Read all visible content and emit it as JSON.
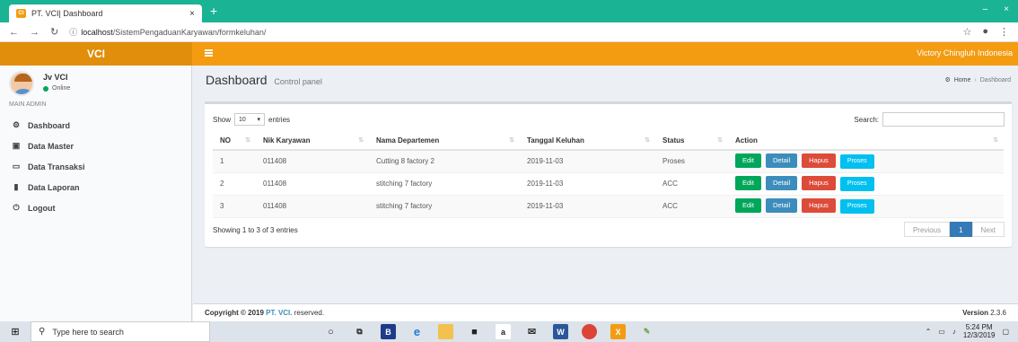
{
  "browser": {
    "tab_title": "PT. VCI| Dashboard",
    "tab_close": "×",
    "new_tab": "+",
    "minimize": "–",
    "close": "×",
    "url_host": "localhost",
    "url_path": "/SistemPengaduanKaryawan/formkeluhan/"
  },
  "header": {
    "logo": "VCI",
    "company": "Victory Chingluh Indonesia"
  },
  "sidebar": {
    "user_name": "Jv VCI",
    "user_status": "Online",
    "nav_header": "MAIN ADMIN",
    "items": [
      {
        "label": "Dashboard",
        "icon": "dashboard-icon"
      },
      {
        "label": "Data Master",
        "icon": "id-card-icon"
      },
      {
        "label": "Data Transaksi",
        "icon": "monitor-icon"
      },
      {
        "label": "Data Laporan",
        "icon": "book-icon"
      },
      {
        "label": "Logout",
        "icon": "power-icon"
      }
    ]
  },
  "content": {
    "title": "Dashboard",
    "subtitle": "Control panel",
    "breadcrumb_home": "Home",
    "breadcrumb_current": "Dashboard"
  },
  "table": {
    "show_label": "Show",
    "entries_value": "10",
    "entries_label": "entries",
    "search_label": "Search:",
    "columns": [
      "NO",
      "Nik Karyawan",
      "Nama Departemen",
      "Tanggal Keluhan",
      "Status",
      "Action"
    ],
    "rows": [
      {
        "no": "1",
        "nik": "011408",
        "dept": "Cutting 8 factory 2",
        "tanggal": "2019-11-03",
        "status": "Proses"
      },
      {
        "no": "2",
        "nik": "011408",
        "dept": "stitching 7 factory",
        "tanggal": "2019-11-03",
        "status": "ACC"
      },
      {
        "no": "3",
        "nik": "011408",
        "dept": "stitching 7 factory",
        "tanggal": "2019-11-03",
        "status": "ACC"
      }
    ],
    "actions": {
      "edit": "Edit",
      "detail": "Detail",
      "hapus": "Hapus",
      "proses": "Proses"
    },
    "info": "Showing 1 to 3 of 3 entries",
    "previous": "Previous",
    "page": "1",
    "next": "Next"
  },
  "footer": {
    "copyright_prefix": "Copyright © 2019",
    "brand": "PT. VCI.",
    "suffix": "reserved.",
    "version_label": "Version",
    "version": "2.3.6"
  },
  "taskbar": {
    "search_placeholder": "Type here to search",
    "time": "5:24 PM",
    "date": "12/3/2019"
  },
  "colors": {
    "header": "#f39c12",
    "logo_bg": "#e08e0b",
    "tab_strip": "#1ab394",
    "edit": "#00a65a",
    "detail": "#3c8dbc",
    "hapus": "#dd4b39",
    "proses": "#00c0ef"
  }
}
